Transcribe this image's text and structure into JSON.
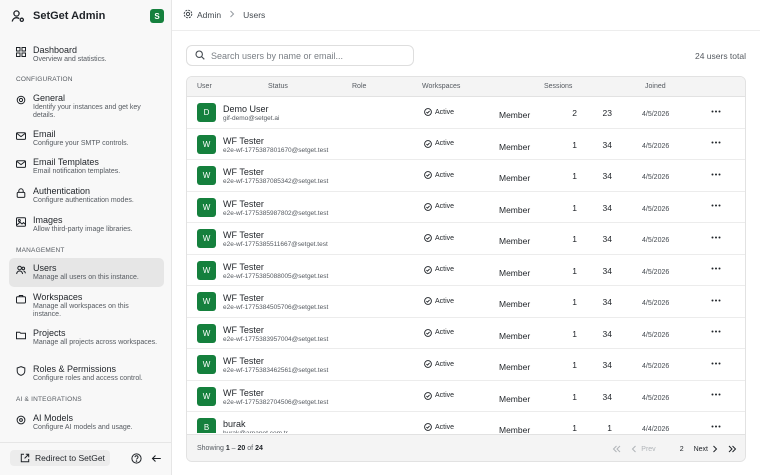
{
  "app": {
    "title": "SetGet Admin",
    "badge": "S"
  },
  "breadcrumb": {
    "root": "Admin",
    "current": "Users"
  },
  "sidebar": {
    "top_items": [
      {
        "label": "Dashboard",
        "desc": "Overview and statistics."
      }
    ],
    "sections": [
      {
        "heading": "CONFIGURATION",
        "items": [
          {
            "label": "General",
            "desc": "Identify your instances and get key details."
          },
          {
            "label": "Email",
            "desc": "Configure your SMTP controls."
          },
          {
            "label": "Email Templates",
            "desc": "Email notification templates."
          },
          {
            "label": "Authentication",
            "desc": "Configure authentication modes."
          },
          {
            "label": "Images",
            "desc": "Allow third-party image libraries."
          }
        ]
      },
      {
        "heading": "MANAGEMENT",
        "items": [
          {
            "label": "Users",
            "desc": "Manage all users on this instance."
          },
          {
            "label": "Workspaces",
            "desc": "Manage all workspaces on this instance."
          },
          {
            "label": "Projects",
            "desc": "Manage all projects across workspaces."
          },
          {
            "label": "Roles & Permissions",
            "desc": "Configure roles and access control."
          }
        ]
      },
      {
        "heading": "AI & INTEGRATIONS",
        "items": [
          {
            "label": "AI Models",
            "desc": "Configure AI models and usage."
          }
        ]
      }
    ],
    "footer": {
      "redirect_label": "Redirect to SetGet"
    }
  },
  "search": {
    "placeholder": "Search users by name or email...",
    "value": ""
  },
  "total_label": "24 users total",
  "table": {
    "columns": [
      "User",
      "Status",
      "Role",
      "Workspaces",
      "Sessions",
      "Joined"
    ],
    "rows": [
      {
        "initial": "D",
        "name": "Demo User",
        "email": "gif-demo@setget.ai",
        "status": "Active",
        "role": "Member",
        "workspaces": "2",
        "sessions": "23",
        "joined": "4/5/2026"
      },
      {
        "initial": "W",
        "name": "WF Tester",
        "email": "e2e-wf-1775387801670@setget.test",
        "status": "Active",
        "role": "Member",
        "workspaces": "1",
        "sessions": "34",
        "joined": "4/5/2026"
      },
      {
        "initial": "W",
        "name": "WF Tester",
        "email": "e2e-wf-1775387085342@setget.test",
        "status": "Active",
        "role": "Member",
        "workspaces": "1",
        "sessions": "34",
        "joined": "4/5/2026"
      },
      {
        "initial": "W",
        "name": "WF Tester",
        "email": "e2e-wf-1775385987802@setget.test",
        "status": "Active",
        "role": "Member",
        "workspaces": "1",
        "sessions": "34",
        "joined": "4/5/2026"
      },
      {
        "initial": "W",
        "name": "WF Tester",
        "email": "e2e-wf-1775385511667@setget.test",
        "status": "Active",
        "role": "Member",
        "workspaces": "1",
        "sessions": "34",
        "joined": "4/5/2026"
      },
      {
        "initial": "W",
        "name": "WF Tester",
        "email": "e2e-wf-1775385088005@setget.test",
        "status": "Active",
        "role": "Member",
        "workspaces": "1",
        "sessions": "34",
        "joined": "4/5/2026"
      },
      {
        "initial": "W",
        "name": "WF Tester",
        "email": "e2e-wf-1775384505706@setget.test",
        "status": "Active",
        "role": "Member",
        "workspaces": "1",
        "sessions": "34",
        "joined": "4/5/2026"
      },
      {
        "initial": "W",
        "name": "WF Tester",
        "email": "e2e-wf-1775383957004@setget.test",
        "status": "Active",
        "role": "Member",
        "workspaces": "1",
        "sessions": "34",
        "joined": "4/5/2026"
      },
      {
        "initial": "W",
        "name": "WF Tester",
        "email": "e2e-wf-1775383462561@setget.test",
        "status": "Active",
        "role": "Member",
        "workspaces": "1",
        "sessions": "34",
        "joined": "4/5/2026"
      },
      {
        "initial": "W",
        "name": "WF Tester",
        "email": "e2e-wf-1775382704506@setget.test",
        "status": "Active",
        "role": "Member",
        "workspaces": "1",
        "sessions": "34",
        "joined": "4/5/2026"
      },
      {
        "initial": "B",
        "name": "burak",
        "email": "burak@arnapet.com.tr",
        "status": "Active",
        "role": "Member",
        "workspaces": "1",
        "sessions": "1",
        "joined": "4/4/2026"
      }
    ]
  },
  "pagination": {
    "showing_prefix": "Showing",
    "range_start": "1",
    "range_sep": "–",
    "range_end": "20",
    "of_label": "of",
    "total": "24",
    "prev_label": "Prev",
    "page_number": "2",
    "next_label": "Next"
  },
  "colors": {
    "avatar_bg": "#15803d",
    "active_row_bg": "#e6e6e6",
    "sidebar_bg": "#f8f8f8"
  }
}
